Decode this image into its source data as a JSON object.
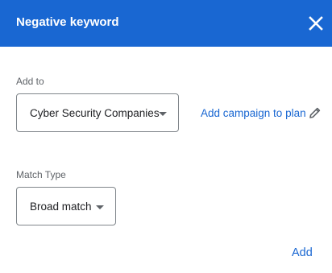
{
  "header": {
    "title": "Negative keyword",
    "close_icon": "close-icon",
    "background_color": "#1967d2"
  },
  "add_to": {
    "label": "Add to",
    "selected_value": "Cyber Security Companies",
    "dropdown_icon": "dropdown-caret-icon",
    "link_label": "Add campaign to plan",
    "edit_icon": "pencil-icon"
  },
  "match_type": {
    "label": "Match Type",
    "selected_value": "Broad match",
    "dropdown_icon": "dropdown-caret-icon"
  },
  "footer": {
    "add_label": "Add",
    "accent_color": "#1967d2"
  }
}
